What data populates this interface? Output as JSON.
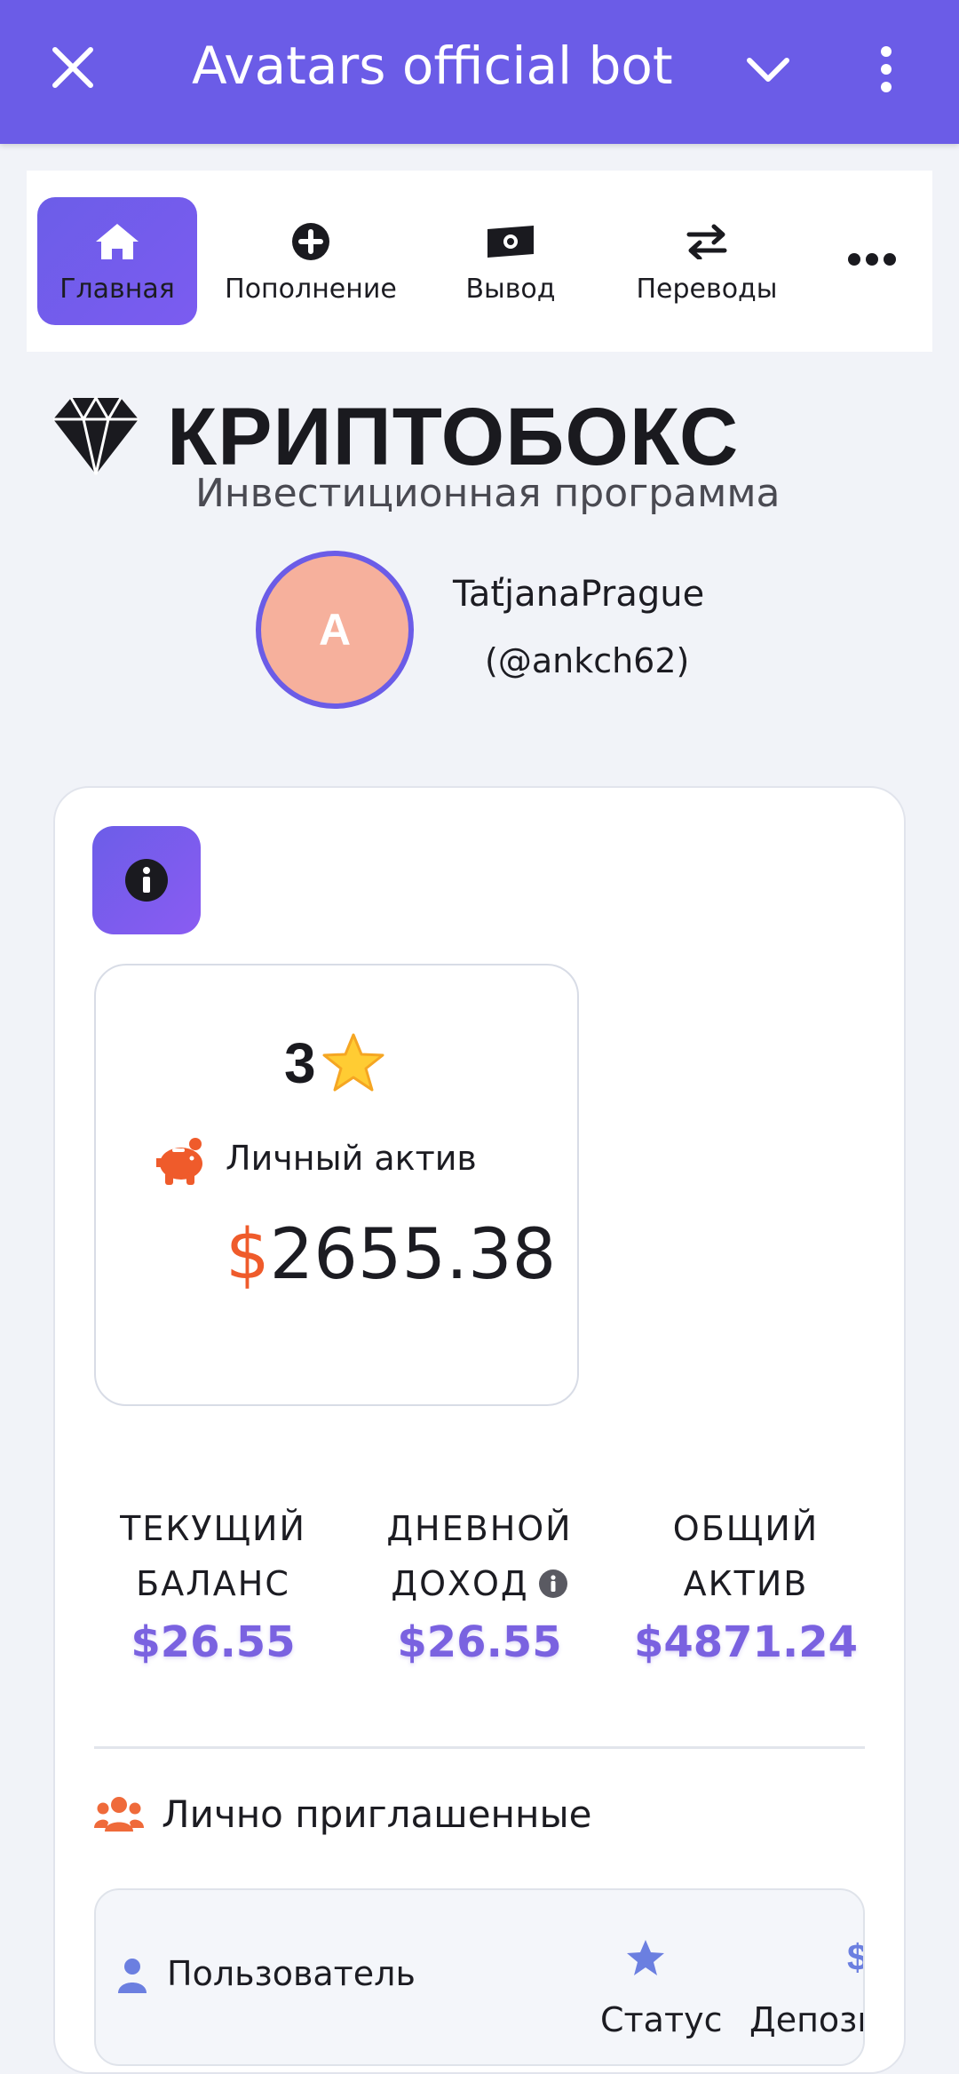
{
  "header": {
    "title": "Avatars official bot",
    "accent": "#6b5ce7"
  },
  "nav": {
    "items": [
      {
        "label": "Главная",
        "icon": "home-icon",
        "active": true
      },
      {
        "label": "Пополнение",
        "icon": "plus-circle-icon",
        "active": false
      },
      {
        "label": "Вывод",
        "icon": "money-icon",
        "active": false
      },
      {
        "label": "Переводы",
        "icon": "transfer-icon",
        "active": false
      }
    ],
    "more_icon": "ellipsis-icon"
  },
  "brand": {
    "name": "КРИПТОБОКС",
    "subtitle": "Инвестиционная программа",
    "logo_icon": "diamond-icon"
  },
  "profile": {
    "avatar_letter": "A",
    "avatar_color": "#f6b09c",
    "name": "TaťjanaPrague",
    "handle": "(@ankch62)"
  },
  "asset": {
    "stars_count": "3",
    "label": "Личный актив",
    "currency": "$",
    "amount": "2655.38"
  },
  "stats": [
    {
      "line1": "ТЕКУЩИЙ",
      "line2": "БАЛАНС",
      "value": "$26.55",
      "has_info": false
    },
    {
      "line1": "ДНЕВНОЙ",
      "line2": "ДОХОД",
      "value": "$26.55",
      "has_info": true
    },
    {
      "line1": "ОБЩИЙ",
      "line2": "АКТИВ",
      "value": "$4871.24",
      "has_info": false
    }
  ],
  "invited": {
    "title": "Лично приглашенные",
    "columns": {
      "user": "Пользователь",
      "status": "Статус",
      "deposit": "Депози",
      "deposit_icon": "$"
    }
  }
}
